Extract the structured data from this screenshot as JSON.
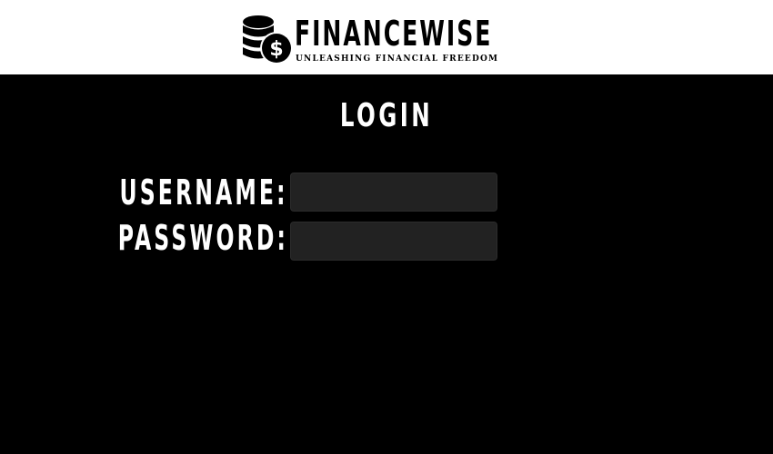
{
  "header": {
    "brand_name": "FINANCEWISE",
    "tagline": "UNLEASHING FINANCIAL FREEDOM",
    "logo_icon": "coin-stack-dollar-icon",
    "background": "#ffffff",
    "text_color": "#000000"
  },
  "login": {
    "title": "LOGIN",
    "username_label": "USERNAME:",
    "password_label": "PASSWORD:",
    "username_value": "",
    "password_value": ""
  },
  "colors": {
    "page_background": "#000000",
    "input_background": "#222222",
    "label_color": "#ffffff"
  }
}
